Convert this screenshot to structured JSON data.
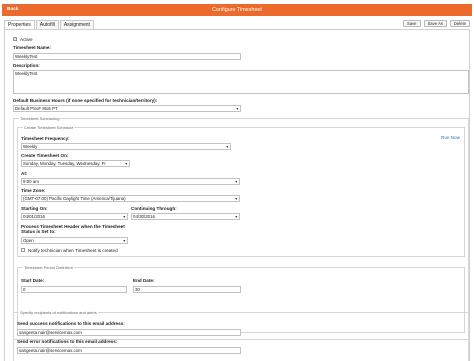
{
  "titlebar": {
    "back_label": "Back",
    "title": "Configure Timesheet",
    "color": "#ec6a2c"
  },
  "tabs": [
    {
      "label": "Properties"
    },
    {
      "label": "Autofill"
    },
    {
      "label": "Assignment"
    }
  ],
  "toolbar": {
    "save_label": "Save",
    "save_as_label": "Save As",
    "delete_label": "Delete"
  },
  "form": {
    "active_label": "Active",
    "active_checked": true,
    "timesheet_name_label": "Timesheet Name:",
    "timesheet_name_value": "WeeklyTest",
    "description_label": "Description:",
    "description_value": "WeeklyTest",
    "business_hours_label": "Default Business Hours (if none specified for technician/territory):",
    "business_hours_value": "Default PSoF 8to5 PT",
    "scheduling_title": "Timesheet Scheduling",
    "schedule_title": "Create Timesheet Schedule",
    "frequency_label": "Timesheet Frequency:",
    "frequency_value": "Weekly",
    "run_now_label": "Run Now",
    "create_on_label": "Create Timesheet On:",
    "create_on_value": "Sunday, Monday, Tuesday, Wednesday, Fr",
    "at_label": "At:",
    "at_value": "9:00 am",
    "timezone_label": "Time Zone:",
    "timezone_value": "(GMT-07:00) Pacific Daylight Time (America/Tijuana)",
    "starting_on_label": "Starting On:",
    "starting_on_value": "04/01/2016",
    "continuing_label": "Continuing Through:",
    "continuing_value": "04/30/2016",
    "process_header_label": "Process Timesheet Header when the Timesheet Status is Set to:",
    "process_header_value": "Open",
    "notify_label": "Notify technician when Timesheet is created",
    "period_title": "Timesheet Period Definition",
    "start_date_label": "Start Date:",
    "start_date_value": "0",
    "end_date_label": "End Date:",
    "end_date_value": "30",
    "notify_section_title": "Specify recipients of notifications and alerts",
    "success_label": "Send success notifications to this email address:",
    "success_value": "sangeeta.nair@servicemax.com",
    "error_label": "Send error notifications to this email address:",
    "error_value": "sangeeta.nair@servicemax.com"
  }
}
